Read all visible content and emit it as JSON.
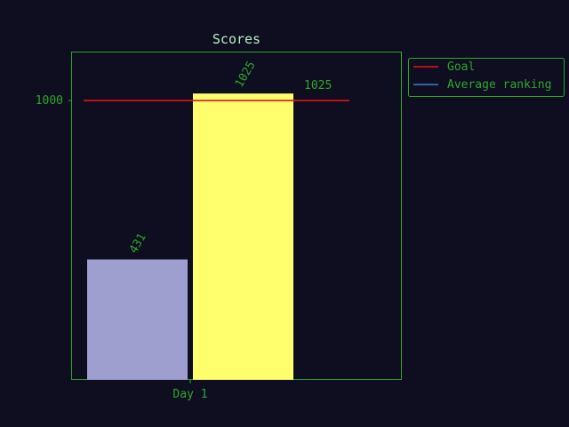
{
  "colors": {
    "background": "#0e0e20",
    "axes": "#2aa82a",
    "text": "#2aa82a",
    "title": "#b8f0c0",
    "goal_line": "#e8101a",
    "average_line": "#3a7ec8",
    "bar_1": "#9f9fcf",
    "bar_2": "#ffff6e"
  },
  "chart_data": {
    "type": "bar",
    "title": "Scores",
    "xlabel": "",
    "ylabel": "",
    "categories": [
      "Day 1"
    ],
    "bars": [
      {
        "value": 431,
        "label": "431",
        "color": "#9f9fcf"
      },
      {
        "value": 1025,
        "label": "1025",
        "color": "#ffff6e"
      }
    ],
    "ylim": [
      0,
      1175
    ],
    "yticks": [
      {
        "value": 1000,
        "label": "1000"
      }
    ],
    "lines": [
      {
        "name": "Goal",
        "value": 1000,
        "color": "#e8101a"
      },
      {
        "name": "Average ranking",
        "value": 1025,
        "label": "1025",
        "color": "#3a7ec8"
      }
    ],
    "legend": {
      "position": "outside-top-right",
      "entries": [
        {
          "label": "Goal",
          "color": "#e8101a"
        },
        {
          "label": "Average ranking",
          "color": "#3a7ec8"
        }
      ]
    },
    "grid": false
  }
}
